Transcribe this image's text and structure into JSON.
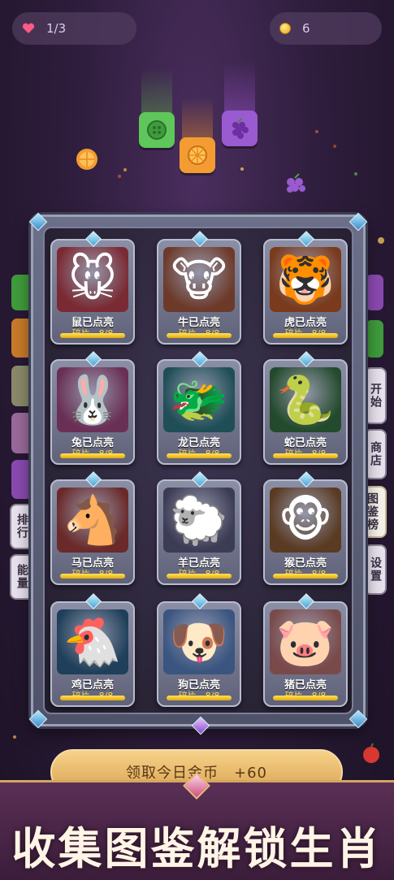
{
  "top": {
    "lives": "1/3",
    "coins": "6"
  },
  "side_tabs": [
    {
      "label": "排行",
      "side": "left"
    },
    {
      "label": "能量",
      "side": "left"
    },
    {
      "label": "开始",
      "side": "right"
    },
    {
      "label": "商店",
      "side": "right"
    },
    {
      "label": "图鉴榜",
      "side": "right",
      "active": true
    },
    {
      "label": "设置",
      "side": "right"
    }
  ],
  "cards": [
    {
      "name": "鼠已点亮",
      "progress": "碎片　8/8",
      "fraction": 1,
      "icon": "rat-icon",
      "glyph": "🐭",
      "bg": "#7a2a33"
    },
    {
      "name": "牛已点亮",
      "progress": "碎片　8/8",
      "fraction": 1,
      "icon": "ox-icon",
      "glyph": "🐮",
      "bg": "#6d3a2a"
    },
    {
      "name": "虎已点亮",
      "progress": "碎片　8/8",
      "fraction": 1,
      "icon": "tiger-icon",
      "glyph": "🐯",
      "bg": "#7a3a1c"
    },
    {
      "name": "兔已点亮",
      "progress": "碎片　8/8",
      "fraction": 1,
      "icon": "rabbit-icon",
      "glyph": "🐰",
      "bg": "#6a2f55"
    },
    {
      "name": "龙已点亮",
      "progress": "碎片　8/8",
      "fraction": 1,
      "icon": "dragon-icon",
      "glyph": "🐲",
      "bg": "#1f4e57"
    },
    {
      "name": "蛇已点亮",
      "progress": "碎片　8/8",
      "fraction": 1,
      "icon": "snake-icon",
      "glyph": "🐍",
      "bg": "#234a2c"
    },
    {
      "name": "马已点亮",
      "progress": "碎片　8/8",
      "fraction": 1,
      "icon": "horse-icon",
      "glyph": "🐴",
      "bg": "#6a2a2a"
    },
    {
      "name": "羊已点亮",
      "progress": "碎片　8/8",
      "fraction": 1,
      "icon": "sheep-icon",
      "glyph": "🐑",
      "bg": "#3c3c55"
    },
    {
      "name": "猴已点亮",
      "progress": "碎片　8/8",
      "fraction": 1,
      "icon": "monkey-icon",
      "glyph": "🐵",
      "bg": "#5a3a22"
    },
    {
      "name": "鸡已点亮",
      "progress": "碎片　8/8",
      "fraction": 1,
      "icon": "rooster-icon",
      "glyph": "🐔",
      "bg": "#1f3f5a"
    },
    {
      "name": "狗已点亮",
      "progress": "碎片　8/8",
      "fraction": 1,
      "icon": "dog-icon",
      "glyph": "🐶",
      "bg": "#3a5580"
    },
    {
      "name": "猪已点亮",
      "progress": "碎片　8/8",
      "fraction": 1,
      "icon": "pig-icon",
      "glyph": "🐷",
      "bg": "#7a4a4a"
    }
  ],
  "claim_button": "领取今日金币　+60",
  "slogan": "收集图鉴解锁生肖",
  "colors": {
    "accent_gold": "#e6a90d",
    "panel": "#5f6278"
  }
}
